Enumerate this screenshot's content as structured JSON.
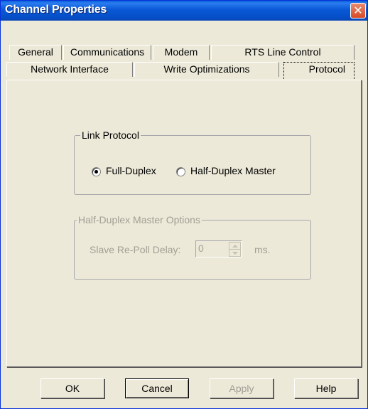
{
  "window": {
    "title": "Channel Properties",
    "close_glyph": "✕"
  },
  "tabs_row1": [
    {
      "label": "General"
    },
    {
      "label": "Communications"
    },
    {
      "label": "Modem"
    },
    {
      "label": "RTS Line Control"
    }
  ],
  "tabs_row2": [
    {
      "label": "Network Interface"
    },
    {
      "label": "Write Optimizations"
    },
    {
      "label": "Protocol",
      "selected": true
    }
  ],
  "link_protocol": {
    "group_label": "Link Protocol",
    "full_duplex_label": "Full-Duplex",
    "half_duplex_label": "Half-Duplex Master",
    "selected": "Full-Duplex"
  },
  "half_duplex_options": {
    "group_label": "Half-Duplex Master Options",
    "slave_repoll_label": "Slave Re-Poll Delay:",
    "slave_repoll_value": "0",
    "unit_label": "ms."
  },
  "buttons": {
    "ok": "OK",
    "cancel": "Cancel",
    "apply": "Apply",
    "help": "Help"
  },
  "icons": {
    "close": "close-icon",
    "spin_up": "spin-up-icon",
    "spin_down": "spin-down-icon"
  }
}
